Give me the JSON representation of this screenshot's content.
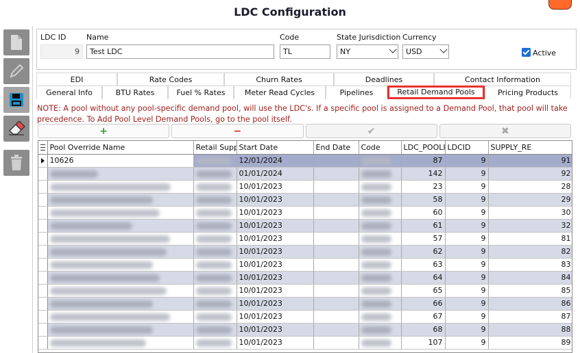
{
  "window": {
    "title": "LDC Configuration"
  },
  "sidebar": {
    "tools": [
      {
        "icon": "new-document-icon"
      },
      {
        "icon": "edit-pencil-icon"
      },
      {
        "icon": "save-disk-icon"
      },
      {
        "icon": "eraser-icon"
      },
      {
        "icon": "trash-icon"
      }
    ]
  },
  "header": {
    "ldc_id_label": "LDC ID",
    "ldc_id_value": "9",
    "name_label": "Name",
    "name_value": "Test LDC",
    "code_label": "Code",
    "code_value": "TL",
    "state_label": "State Jurisdiction",
    "state_value": "NY",
    "currency_label": "Currency",
    "currency_value": "USD",
    "active_label": "Active",
    "active_checked": true
  },
  "tabs": {
    "row1": [
      "EDI",
      "Rate Codes",
      "Churn Rates",
      "Deadlines",
      "Contact Information"
    ],
    "row2": [
      "General Info",
      "BTU Rates",
      "Fuel % Rates",
      "Meter Read Cycles",
      "Pipelines",
      "Retail Demand Pools",
      "Pricing Products"
    ],
    "active": "Retail Demand Pools"
  },
  "note": "NOTE: A pool without any pool-specific demand pool, will use the LDC's.  If a specific pool is assigned to a Demand Pool, that pool will take precedence. To Add Pool Level Demand Pools, go to the pool itself.",
  "actions": {
    "add": "+",
    "remove": "−",
    "confirm": "✔",
    "cancel": "✖"
  },
  "grid": {
    "columns": [
      "Pool Override Name",
      "Retail Supp",
      "Start Date",
      "End Date",
      "Code",
      "LDC_POOLII",
      "LDCID",
      "SUPPLY_RE"
    ],
    "rows": [
      {
        "pool": "10626",
        "start": "12/01/2024",
        "end": "",
        "pool_id": "87",
        "ldcid": "9",
        "supply": "91"
      },
      {
        "pool": "",
        "start": "01/01/2024",
        "end": "",
        "pool_id": "142",
        "ldcid": "9",
        "supply": "92"
      },
      {
        "pool": "",
        "start": "10/01/2023",
        "end": "",
        "pool_id": "23",
        "ldcid": "9",
        "supply": "28"
      },
      {
        "pool": "",
        "start": "10/01/2023",
        "end": "",
        "pool_id": "58",
        "ldcid": "9",
        "supply": "29"
      },
      {
        "pool": "",
        "start": "10/01/2023",
        "end": "",
        "pool_id": "60",
        "ldcid": "9",
        "supply": "30"
      },
      {
        "pool": "",
        "start": "10/01/2023",
        "end": "",
        "pool_id": "61",
        "ldcid": "9",
        "supply": "32"
      },
      {
        "pool": "",
        "start": "10/01/2023",
        "end": "",
        "pool_id": "57",
        "ldcid": "9",
        "supply": "81"
      },
      {
        "pool": "",
        "start": "10/01/2023",
        "end": "",
        "pool_id": "62",
        "ldcid": "9",
        "supply": "82"
      },
      {
        "pool": "",
        "start": "10/01/2023",
        "end": "",
        "pool_id": "63",
        "ldcid": "9",
        "supply": "83"
      },
      {
        "pool": "",
        "start": "10/01/2023",
        "end": "",
        "pool_id": "64",
        "ldcid": "9",
        "supply": "84"
      },
      {
        "pool": "",
        "start": "10/01/2023",
        "end": "",
        "pool_id": "65",
        "ldcid": "9",
        "supply": "85"
      },
      {
        "pool": "",
        "start": "10/01/2023",
        "end": "",
        "pool_id": "66",
        "ldcid": "9",
        "supply": "86"
      },
      {
        "pool": "",
        "start": "10/01/2023",
        "end": "",
        "pool_id": "67",
        "ldcid": "9",
        "supply": "87"
      },
      {
        "pool": "",
        "start": "10/01/2023",
        "end": "",
        "pool_id": "68",
        "ldcid": "9",
        "supply": "88"
      },
      {
        "pool": "",
        "start": "10/01/2023",
        "end": "",
        "pool_id": "107",
        "ldcid": "9",
        "supply": "89"
      }
    ]
  },
  "colors": {
    "note_text": "#a0211d",
    "active_tab_border": "#e8322e",
    "selected_row": "#a4accc",
    "alt_row": "#d6dae6",
    "add_green": "#2e9e2e",
    "remove_red": "#d0281f"
  }
}
